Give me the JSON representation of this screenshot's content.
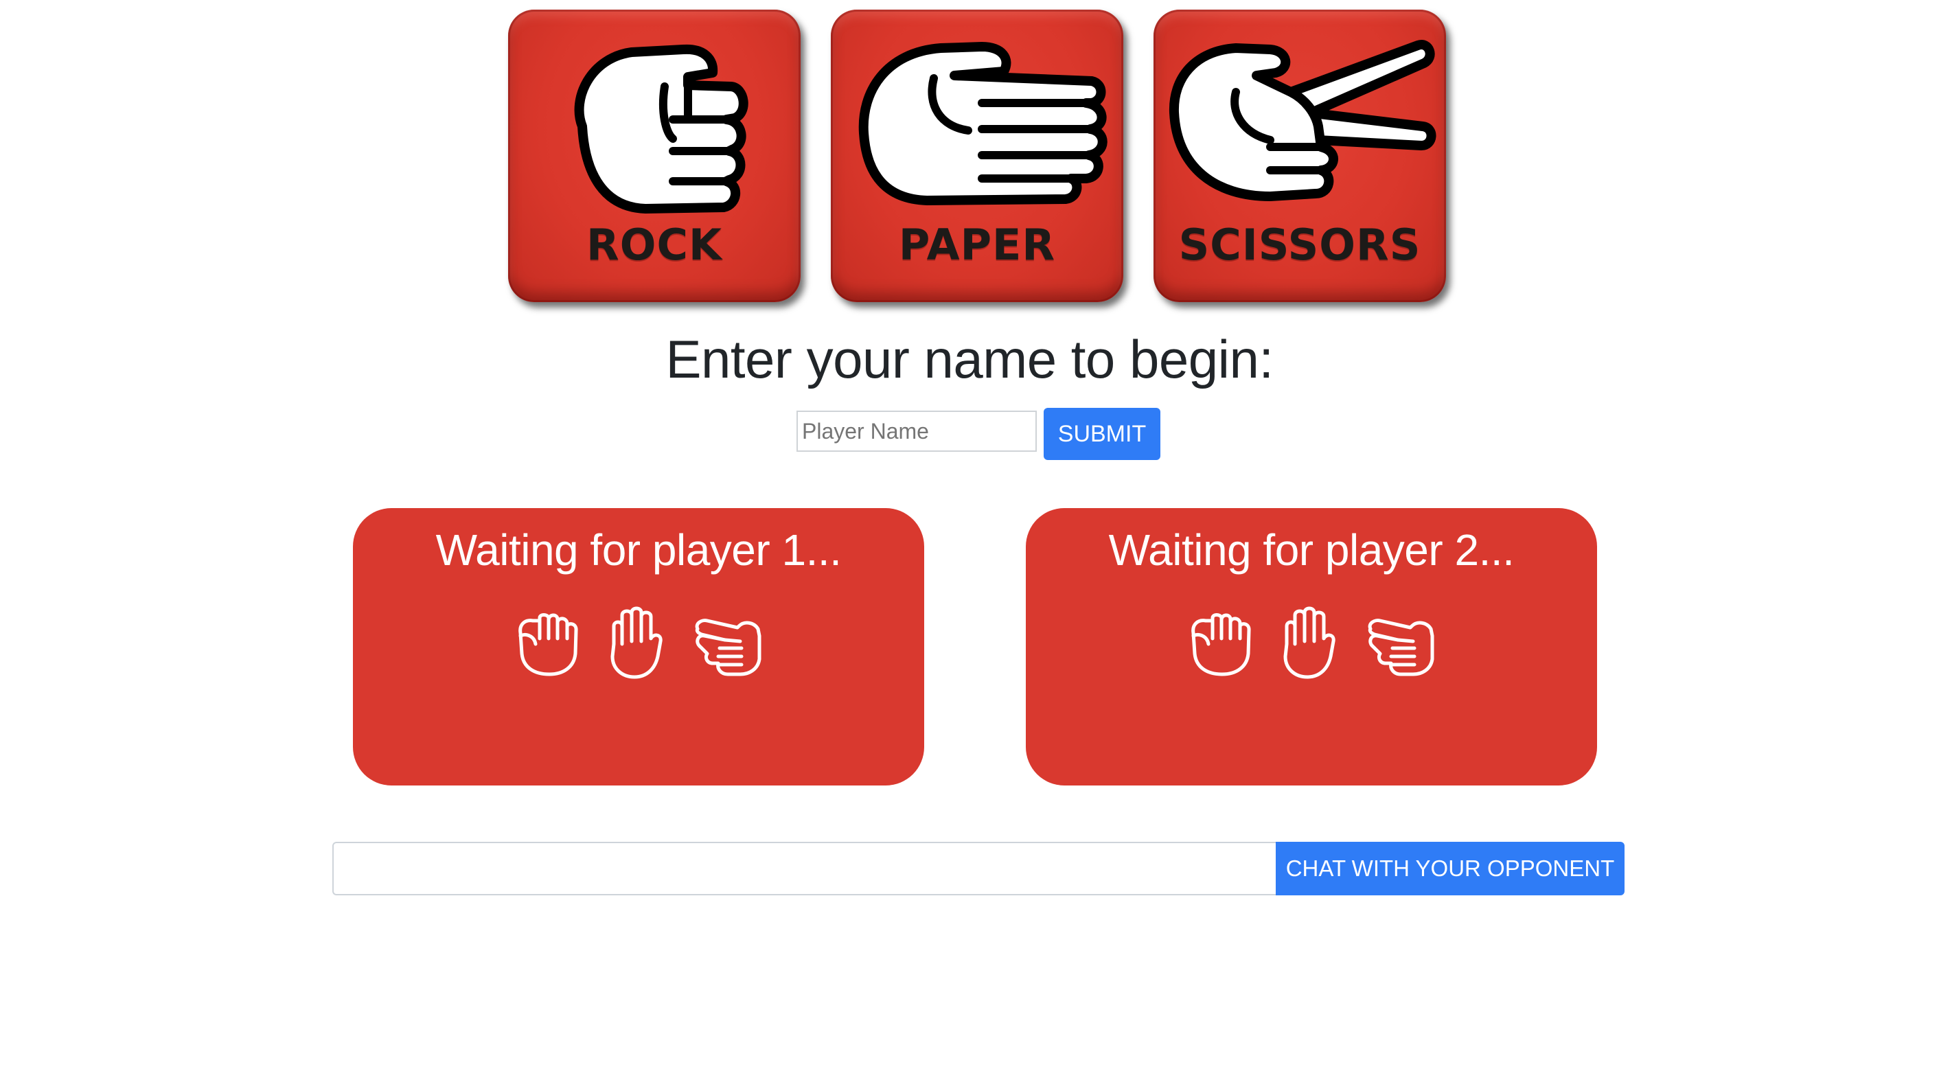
{
  "logos": [
    {
      "label": "ROCK",
      "icon": "rock-hand-icon"
    },
    {
      "label": "PAPER",
      "icon": "paper-hand-icon"
    },
    {
      "label": "SCISSORS",
      "icon": "scissors-hand-icon"
    }
  ],
  "heading": "Enter your name to begin:",
  "name_form": {
    "placeholder": "Player Name",
    "value": "",
    "submit_label": "SUBMIT"
  },
  "players": [
    {
      "status": "Waiting for player 1...",
      "choices": [
        "rock-icon",
        "paper-icon",
        "scissors-icon"
      ]
    },
    {
      "status": "Waiting for player 2...",
      "choices": [
        "rock-icon",
        "paper-icon",
        "scissors-icon"
      ]
    }
  ],
  "chat": {
    "value": "",
    "button_label": "CHAT WITH YOUR OPPONENT"
  },
  "colors": {
    "panel_red": "#d9392f",
    "button_blue": "#2f7cf6",
    "heading_text": "#212529"
  }
}
